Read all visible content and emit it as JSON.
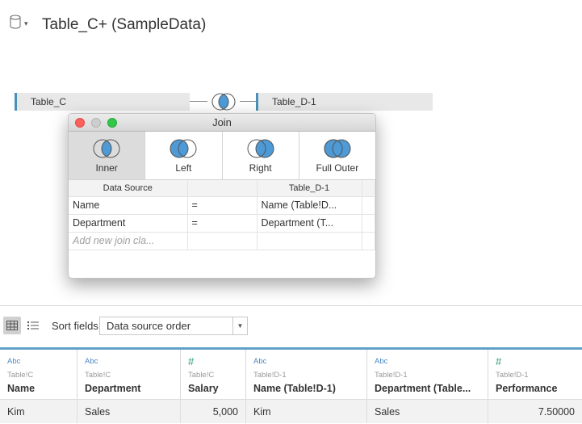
{
  "header": {
    "title": "Table_C+ (SampleData)"
  },
  "canvas": {
    "left_table": "Table_C",
    "right_table": "Table_D-1"
  },
  "dialog": {
    "title": "Join",
    "join_types": [
      {
        "label": "Inner",
        "selected": true
      },
      {
        "label": "Left",
        "selected": false
      },
      {
        "label": "Right",
        "selected": false
      },
      {
        "label": "Full Outer",
        "selected": false
      }
    ],
    "clause_headers": {
      "left": "Data Source",
      "right": "Table_D-1"
    },
    "clauses": [
      {
        "left": "Name",
        "op": "=",
        "right": "Name (Table!D..."
      },
      {
        "left": "Department",
        "op": "=",
        "right": "Department (T..."
      }
    ],
    "add_clause_placeholder": "Add new join cla..."
  },
  "toolbar": {
    "sort_label": "Sort fields",
    "sort_value": "Data source order"
  },
  "grid": {
    "columns": [
      {
        "type": "Abc",
        "source": "Table!C",
        "name": "Name"
      },
      {
        "type": "Abc",
        "source": "Table!C",
        "name": "Department"
      },
      {
        "type": "#",
        "source": "Table!C",
        "name": "Salary"
      },
      {
        "type": "Abc",
        "source": "Table!D-1",
        "name": "Name (Table!D-1)"
      },
      {
        "type": "Abc",
        "source": "Table!D-1",
        "name": "Department (Table..."
      },
      {
        "type": "#",
        "source": "Table!D-1",
        "name": "Performance"
      }
    ],
    "rows": [
      [
        "Kim",
        "Sales",
        "5,000",
        "Kim",
        "Sales",
        "7.50000"
      ]
    ]
  },
  "colors": {
    "accent": "#4a90b8",
    "join_fill": "#4d9ad6",
    "number_type": "#2b9b6f",
    "string_type": "#4a87c4"
  }
}
